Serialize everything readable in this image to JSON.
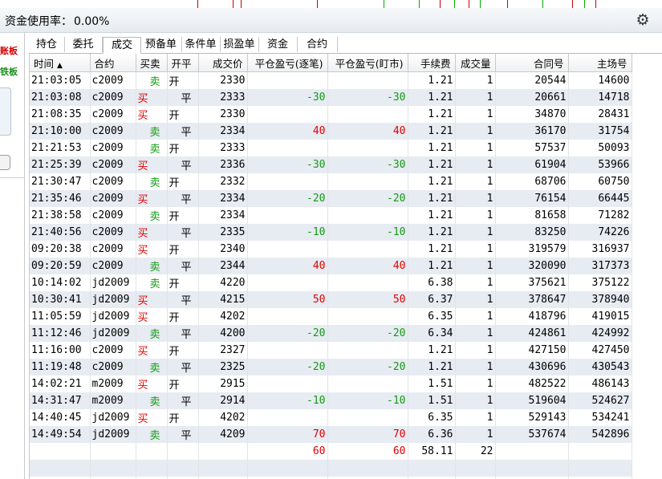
{
  "header": {
    "title_label": "资金使用率：",
    "title_value": "0.00%",
    "settings_icon": "gear-icon"
  },
  "left_panel": {
    "red_label": "账板",
    "green_label": "铁板"
  },
  "tabs": [
    {
      "label": "持仓"
    },
    {
      "label": "委托"
    },
    {
      "label": "成交",
      "active": true
    },
    {
      "label": "预备单"
    },
    {
      "label": "条件单"
    },
    {
      "label": "损盈单"
    },
    {
      "label": "资金"
    },
    {
      "label": "合约"
    }
  ],
  "table": {
    "columns": [
      "时间",
      "合约",
      "买卖",
      "开平",
      "成交价",
      "平仓盈亏(逐笔)",
      "平仓盈亏(盯市)",
      "手续费",
      "成交量",
      "合同号",
      "主场号"
    ],
    "sort_indicator": "▲",
    "rows": [
      {
        "time": "21:03:05",
        "contract": "c2009",
        "side": "卖",
        "oc": "开",
        "price": "2330",
        "pnl_trade": "",
        "pnl_mtm": "",
        "fee": "1.21",
        "vol": "1",
        "order_no": "20544",
        "match_no": "14600"
      },
      {
        "time": "21:03:08",
        "contract": "c2009",
        "side": "买",
        "oc": "平",
        "price": "2333",
        "pnl_trade": "-30",
        "pnl_mtm": "-30",
        "fee": "1.21",
        "vol": "1",
        "order_no": "20661",
        "match_no": "14718"
      },
      {
        "time": "21:08:35",
        "contract": "c2009",
        "side": "买",
        "oc": "开",
        "price": "2330",
        "pnl_trade": "",
        "pnl_mtm": "",
        "fee": "1.21",
        "vol": "1",
        "order_no": "34870",
        "match_no": "28431"
      },
      {
        "time": "21:10:00",
        "contract": "c2009",
        "side": "卖",
        "oc": "平",
        "price": "2334",
        "pnl_trade": "40",
        "pnl_mtm": "40",
        "fee": "1.21",
        "vol": "1",
        "order_no": "36170",
        "match_no": "31754"
      },
      {
        "time": "21:21:53",
        "contract": "c2009",
        "side": "卖",
        "oc": "开",
        "price": "2333",
        "pnl_trade": "",
        "pnl_mtm": "",
        "fee": "1.21",
        "vol": "1",
        "order_no": "57537",
        "match_no": "50093"
      },
      {
        "time": "21:25:39",
        "contract": "c2009",
        "side": "买",
        "oc": "平",
        "price": "2336",
        "pnl_trade": "-30",
        "pnl_mtm": "-30",
        "fee": "1.21",
        "vol": "1",
        "order_no": "61904",
        "match_no": "53966"
      },
      {
        "time": "21:30:47",
        "contract": "c2009",
        "side": "卖",
        "oc": "开",
        "price": "2332",
        "pnl_trade": "",
        "pnl_mtm": "",
        "fee": "1.21",
        "vol": "1",
        "order_no": "68706",
        "match_no": "60750"
      },
      {
        "time": "21:35:46",
        "contract": "c2009",
        "side": "买",
        "oc": "平",
        "price": "2334",
        "pnl_trade": "-20",
        "pnl_mtm": "-20",
        "fee": "1.21",
        "vol": "1",
        "order_no": "76154",
        "match_no": "66445"
      },
      {
        "time": "21:38:58",
        "contract": "c2009",
        "side": "卖",
        "oc": "开",
        "price": "2334",
        "pnl_trade": "",
        "pnl_mtm": "",
        "fee": "1.21",
        "vol": "1",
        "order_no": "81658",
        "match_no": "71282"
      },
      {
        "time": "21:40:56",
        "contract": "c2009",
        "side": "买",
        "oc": "平",
        "price": "2335",
        "pnl_trade": "-10",
        "pnl_mtm": "-10",
        "fee": "1.21",
        "vol": "1",
        "order_no": "83250",
        "match_no": "74226"
      },
      {
        "time": "09:20:38",
        "contract": "c2009",
        "side": "买",
        "oc": "开",
        "price": "2340",
        "pnl_trade": "",
        "pnl_mtm": "",
        "fee": "1.21",
        "vol": "1",
        "order_no": "319579",
        "match_no": "316937"
      },
      {
        "time": "09:20:59",
        "contract": "c2009",
        "side": "卖",
        "oc": "平",
        "price": "2344",
        "pnl_trade": "40",
        "pnl_mtm": "40",
        "fee": "1.21",
        "vol": "1",
        "order_no": "320090",
        "match_no": "317373"
      },
      {
        "time": "10:14:02",
        "contract": "jd2009",
        "side": "卖",
        "oc": "开",
        "price": "4220",
        "pnl_trade": "",
        "pnl_mtm": "",
        "fee": "6.38",
        "vol": "1",
        "order_no": "375621",
        "match_no": "375122"
      },
      {
        "time": "10:30:41",
        "contract": "jd2009",
        "side": "买",
        "oc": "平",
        "price": "4215",
        "pnl_trade": "50",
        "pnl_mtm": "50",
        "fee": "6.37",
        "vol": "1",
        "order_no": "378647",
        "match_no": "378940"
      },
      {
        "time": "11:05:59",
        "contract": "jd2009",
        "side": "买",
        "oc": "开",
        "price": "4202",
        "pnl_trade": "",
        "pnl_mtm": "",
        "fee": "6.35",
        "vol": "1",
        "order_no": "418796",
        "match_no": "419015"
      },
      {
        "time": "11:12:46",
        "contract": "jd2009",
        "side": "卖",
        "oc": "平",
        "price": "4200",
        "pnl_trade": "-20",
        "pnl_mtm": "-20",
        "fee": "6.34",
        "vol": "1",
        "order_no": "424861",
        "match_no": "424992"
      },
      {
        "time": "11:16:00",
        "contract": "c2009",
        "side": "买",
        "oc": "开",
        "price": "2327",
        "pnl_trade": "",
        "pnl_mtm": "",
        "fee": "1.21",
        "vol": "1",
        "order_no": "427150",
        "match_no": "427450"
      },
      {
        "time": "11:19:48",
        "contract": "c2009",
        "side": "卖",
        "oc": "平",
        "price": "2325",
        "pnl_trade": "-20",
        "pnl_mtm": "-20",
        "fee": "1.21",
        "vol": "1",
        "order_no": "430696",
        "match_no": "430543"
      },
      {
        "time": "14:02:21",
        "contract": "m2009",
        "side": "买",
        "oc": "开",
        "price": "2915",
        "pnl_trade": "",
        "pnl_mtm": "",
        "fee": "1.51",
        "vol": "1",
        "order_no": "482522",
        "match_no": "486143"
      },
      {
        "time": "14:31:47",
        "contract": "m2009",
        "side": "卖",
        "oc": "平",
        "price": "2914",
        "pnl_trade": "-10",
        "pnl_mtm": "-10",
        "fee": "1.51",
        "vol": "1",
        "order_no": "519604",
        "match_no": "524627"
      },
      {
        "time": "14:40:45",
        "contract": "jd2009",
        "side": "买",
        "oc": "开",
        "price": "4202",
        "pnl_trade": "",
        "pnl_mtm": "",
        "fee": "6.35",
        "vol": "1",
        "order_no": "529143",
        "match_no": "534241"
      },
      {
        "time": "14:49:54",
        "contract": "jd2009",
        "side": "卖",
        "oc": "平",
        "price": "4209",
        "pnl_trade": "70",
        "pnl_mtm": "70",
        "fee": "6.36",
        "vol": "1",
        "order_no": "537674",
        "match_no": "542896"
      }
    ],
    "totals": {
      "pnl_trade": "60",
      "pnl_mtm": "60",
      "fee": "58.11",
      "vol": "22"
    }
  },
  "colors": {
    "buy": "#e00000",
    "sell": "#129a12",
    "profit": "#e00000",
    "loss": "#129a12",
    "row_alt": "#e7ebf2"
  }
}
